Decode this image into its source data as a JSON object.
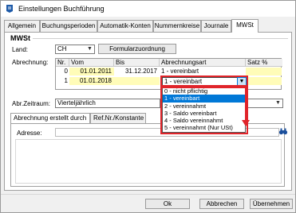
{
  "window": {
    "title": "Einstellungen Buchführung"
  },
  "tabs": [
    {
      "label": "Allgemein",
      "active": false
    },
    {
      "label": "Buchungsperioden",
      "active": false
    },
    {
      "label": "Automatik-Konten",
      "active": false
    },
    {
      "label": "Nummernkreise",
      "active": false
    },
    {
      "label": "Journale",
      "active": false
    },
    {
      "label": "MWSt",
      "active": true
    }
  ],
  "mwst": {
    "group_label": "MWSt",
    "land_label": "Land:",
    "land_value": "CH",
    "formular_button": "Formularzuordnung",
    "abrechnung_label": "Abrechnung:",
    "grid": {
      "columns": [
        "Nr.",
        "Vom",
        "Bis",
        "Abrechnungsart",
        "Satz %"
      ],
      "rows": [
        {
          "nr": "0",
          "vom": "01.01.2011",
          "bis": "31.12.2017",
          "art": "1 - vereinbart",
          "satz": ""
        },
        {
          "nr": "1",
          "vom": "01.01.2018",
          "bis": "",
          "art": "1 - vereinbart",
          "satz": ""
        }
      ]
    },
    "dropdown_options": [
      "0 - nicht pflichtig",
      "1 - vereinbart",
      "2 - vereinnahmt",
      "3 - Saldo vereinbart",
      "4 - Saldo vereinnahmt",
      "5 - vereinnahmt (Nur USt)"
    ],
    "dropdown_highlight_index": 1,
    "abr_zeitraum_label": "Abr.Zeitraum:",
    "abr_zeitraum_value": "Vierteljährlich"
  },
  "subtabs": [
    {
      "label": "Abrechnung erstellt durch",
      "active": true
    },
    {
      "label": "Ref.Nr./Konstante",
      "active": false
    }
  ],
  "adresse_label": "Adresse:",
  "buttons": {
    "ok": "Ok",
    "cancel": "Abbrechen",
    "apply": "Übernehmen"
  },
  "colors": {
    "accent": "#0078d7",
    "highlight_red": "#e0242a",
    "row_yellow": "#fffcb8"
  }
}
